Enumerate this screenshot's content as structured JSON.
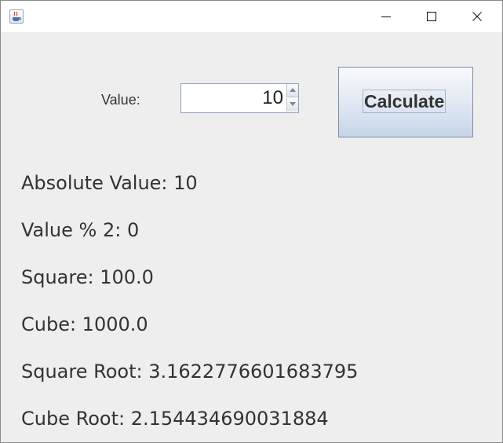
{
  "window": {
    "icon": "java-coffee-cup-icon",
    "controls": {
      "minimize": "minimize-icon",
      "maximize": "maximize-icon",
      "close": "close-icon"
    }
  },
  "form": {
    "value_label": "Value:",
    "value": "10",
    "calculate_label": "Calculate"
  },
  "results": {
    "absolute": "Absolute Value: 10",
    "modulo": "Value % 2: 0",
    "square": "Square: 100.0",
    "cube": "Cube: 1000.0",
    "square_root": "Square Root: 3.1622776601683795",
    "cube_root": "Cube Root: 2.154434690031884"
  },
  "colors": {
    "window_bg": "#eeeeee",
    "titlebar_bg": "#ffffff",
    "text": "#333333",
    "button_gradient_top": "#f7f9fc",
    "button_gradient_bottom": "#c6d5e8"
  }
}
